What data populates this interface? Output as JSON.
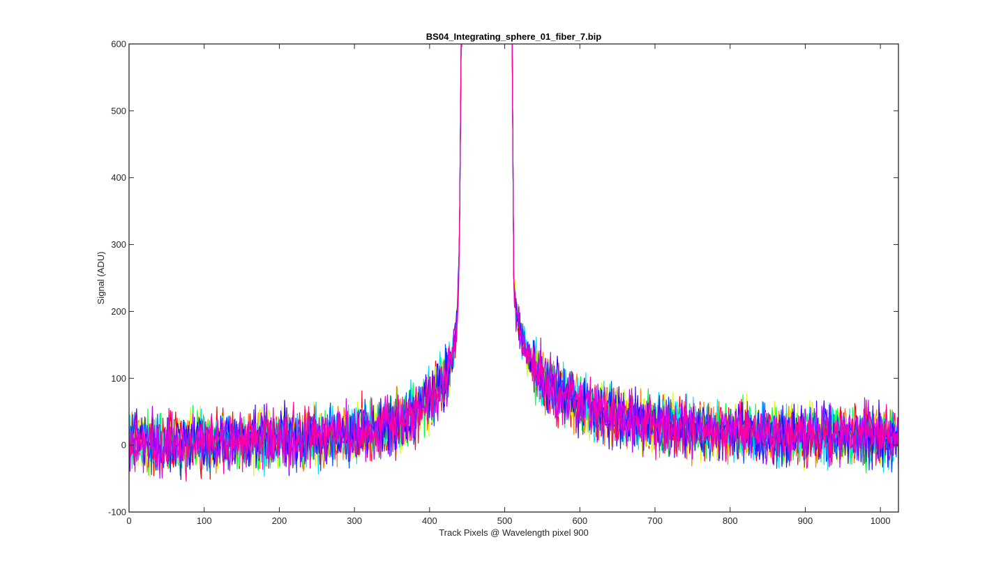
{
  "chart_data": {
    "type": "line",
    "title": "BS04_Integrating_sphere_01_fiber_7.bip",
    "xlabel": "Track Pixels @ Wavelength pixel 900",
    "ylabel": "Signal (ADU)",
    "xlim": [
      0,
      1024
    ],
    "ylim": [
      -100,
      600
    ],
    "xticks": [
      0,
      100,
      200,
      300,
      400,
      500,
      600,
      700,
      800,
      900,
      1000
    ],
    "yticks": [
      -100,
      0,
      100,
      200,
      300,
      400,
      500,
      600
    ],
    "xtick_labels": [
      "0",
      "100",
      "200",
      "300",
      "400",
      "500",
      "600",
      "700",
      "800",
      "900",
      "1000"
    ],
    "ytick_labels": [
      "-100",
      "0",
      "100",
      "200",
      "300",
      "400",
      "500",
      "600"
    ],
    "grid": false,
    "legend": "none",
    "x": [
      0,
      20,
      40,
      60,
      80,
      100,
      120,
      140,
      160,
      180,
      200,
      220,
      240,
      260,
      280,
      300,
      320,
      340,
      360,
      380,
      400,
      410,
      420,
      425,
      430,
      435,
      438,
      440,
      442,
      510,
      512,
      515,
      520,
      525,
      530,
      540,
      550,
      560,
      570,
      580,
      590,
      600,
      620,
      640,
      660,
      680,
      700,
      750,
      800,
      850,
      900,
      950,
      1000,
      1023
    ],
    "series": [
      {
        "color": "#ff0000",
        "values": [
          5,
          2,
          4,
          5,
          5,
          6,
          6,
          7,
          7,
          8,
          9,
          10,
          12,
          13,
          15,
          18,
          22,
          27,
          35,
          48,
          70,
          82,
          100,
          112,
          130,
          165,
          220,
          330,
          600,
          600,
          250,
          200,
          170,
          150,
          135,
          115,
          100,
          90,
          82,
          74,
          68,
          62,
          52,
          44,
          38,
          33,
          30,
          24,
          20,
          17,
          15,
          14,
          13,
          13
        ]
      },
      {
        "color": "#ff8000",
        "values": [
          5,
          3,
          4,
          5,
          5,
          6,
          6,
          7,
          7,
          8,
          9,
          10,
          11,
          13,
          15,
          18,
          22,
          27,
          35,
          48,
          70,
          82,
          100,
          112,
          130,
          165,
          220,
          330,
          600,
          600,
          250,
          200,
          170,
          150,
          135,
          115,
          100,
          90,
          82,
          74,
          68,
          62,
          52,
          44,
          38,
          33,
          30,
          24,
          20,
          17,
          15,
          14,
          13,
          13
        ]
      },
      {
        "color": "#d4ff00",
        "values": [
          5,
          3,
          4,
          5,
          5,
          6,
          6,
          7,
          7,
          8,
          9,
          10,
          11,
          13,
          15,
          18,
          22,
          27,
          35,
          48,
          70,
          82,
          100,
          112,
          130,
          165,
          220,
          330,
          600,
          600,
          250,
          200,
          170,
          150,
          135,
          115,
          100,
          90,
          82,
          74,
          68,
          62,
          52,
          44,
          38,
          33,
          30,
          24,
          20,
          17,
          15,
          14,
          13,
          13
        ]
      },
      {
        "color": "#00ff40",
        "values": [
          5,
          3,
          4,
          5,
          5,
          6,
          6,
          7,
          7,
          8,
          9,
          10,
          11,
          13,
          15,
          18,
          22,
          27,
          35,
          48,
          70,
          82,
          100,
          112,
          130,
          165,
          220,
          330,
          600,
          600,
          250,
          200,
          170,
          150,
          135,
          115,
          100,
          90,
          82,
          74,
          68,
          62,
          52,
          44,
          38,
          33,
          30,
          24,
          20,
          17,
          15,
          14,
          13,
          13
        ]
      },
      {
        "color": "#00e0ff",
        "values": [
          5,
          3,
          4,
          5,
          5,
          6,
          6,
          7,
          7,
          8,
          9,
          10,
          11,
          13,
          15,
          18,
          22,
          27,
          35,
          48,
          70,
          82,
          100,
          112,
          130,
          165,
          220,
          330,
          600,
          600,
          250,
          200,
          170,
          150,
          135,
          115,
          100,
          90,
          82,
          74,
          68,
          62,
          52,
          44,
          38,
          33,
          30,
          24,
          20,
          17,
          15,
          14,
          13,
          13
        ]
      },
      {
        "color": "#0050ff",
        "values": [
          5,
          3,
          4,
          5,
          5,
          6,
          6,
          7,
          7,
          8,
          9,
          10,
          11,
          13,
          15,
          18,
          22,
          27,
          35,
          48,
          70,
          82,
          100,
          112,
          130,
          165,
          220,
          330,
          600,
          600,
          250,
          200,
          170,
          150,
          135,
          115,
          100,
          90,
          82,
          74,
          68,
          62,
          52,
          44,
          38,
          33,
          30,
          24,
          20,
          17,
          15,
          14,
          13,
          13
        ]
      },
      {
        "color": "#3000ff",
        "values": [
          5,
          3,
          4,
          5,
          5,
          6,
          6,
          7,
          7,
          8,
          9,
          10,
          11,
          13,
          15,
          18,
          22,
          27,
          35,
          48,
          70,
          82,
          100,
          112,
          130,
          165,
          220,
          330,
          600,
          600,
          250,
          200,
          170,
          150,
          135,
          115,
          100,
          90,
          82,
          74,
          68,
          62,
          52,
          44,
          38,
          33,
          30,
          24,
          20,
          17,
          15,
          14,
          13,
          13
        ]
      },
      {
        "color": "#c000ff",
        "values": [
          5,
          3,
          4,
          5,
          5,
          6,
          6,
          7,
          7,
          8,
          9,
          10,
          11,
          13,
          15,
          18,
          22,
          27,
          35,
          48,
          70,
          82,
          100,
          112,
          130,
          165,
          220,
          330,
          600,
          600,
          250,
          200,
          170,
          150,
          135,
          115,
          100,
          90,
          82,
          74,
          68,
          62,
          52,
          44,
          38,
          33,
          30,
          24,
          20,
          17,
          15,
          14,
          13,
          13
        ]
      },
      {
        "color": "#ff00a0",
        "values": [
          5,
          3,
          4,
          5,
          5,
          6,
          6,
          7,
          7,
          8,
          9,
          10,
          11,
          13,
          15,
          18,
          22,
          27,
          35,
          48,
          70,
          82,
          100,
          112,
          130,
          165,
          220,
          330,
          600,
          600,
          250,
          200,
          170,
          150,
          135,
          115,
          100,
          90,
          82,
          74,
          68,
          62,
          52,
          44,
          38,
          33,
          30,
          24,
          20,
          17,
          15,
          14,
          13,
          13
        ]
      }
    ],
    "noise_amplitude_adu": 30,
    "gap_x": [
      443,
      509
    ]
  }
}
